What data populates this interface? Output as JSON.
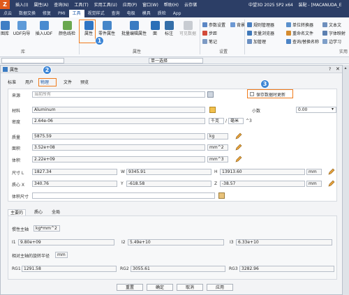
{
  "menubar": {
    "items": [
      "插入(I)",
      "属性(A)",
      "查询(N)",
      "工具(T)",
      "实用工具(U)",
      "应用(P)",
      "窗口(W)",
      "帮助(H)",
      "云存储"
    ],
    "title": "中望3D 2025 SP2 x64",
    "doc": "装配 - [MACANUDA_E"
  },
  "tabs": [
    "点云",
    "数据交换",
    "修复",
    "PMI",
    "工具",
    "视觉样式",
    "查询",
    "电极",
    "模具",
    "质检",
    "App"
  ],
  "ribbon": {
    "left_btns": [
      "图库",
      "UDF向导",
      "插入UDF",
      "属性",
      "零件属性",
      "批量编辑属性",
      "面",
      "标注",
      "可见数据"
    ],
    "glue_label": "颜色线检",
    "group_labels": {
      "lib": "库",
      "attr": "属性",
      "settings": "设置"
    },
    "settings": [
      "参数设置",
      "背景",
      "步距",
      "笔记"
    ],
    "tools": [
      "规则管理器",
      "单位转换器",
      "文本文",
      "变量浏览器",
      "重命名文件",
      "字体映射",
      "加管理",
      "查询/替换名称",
      "边学习"
    ],
    "right_label": "实用"
  },
  "filter": {
    "left": "",
    "mode": "单一选择"
  },
  "dialog": {
    "title": "属性",
    "tabs": [
      "标准",
      "用户",
      "物理",
      "文件",
      "预览"
    ],
    "active_tab": "物理",
    "source_label": "来源",
    "source_value": "当前所有",
    "material_label": "材料",
    "material_value": "Aluminum",
    "decimal_label": "小数",
    "decimal_value": "0.00",
    "density_label": "密度",
    "density_value": "2.64e-06",
    "density_unit1": "千克",
    "density_unit2": "毫米",
    "density_exp": "^3",
    "save_checkbox_label": "保存数据时更新",
    "mass_label": "质量",
    "mass_value": "5875.59",
    "mass_unit": "kg",
    "area_label": "面积",
    "area_value": "3.52e+08",
    "area_unit": "mm^2",
    "volume_label": "体积",
    "volume_value": "2.22e+09",
    "volume_unit": "mm^3",
    "size_label": "尺寸 L",
    "size_l": "1827.34",
    "size_w_label": "W",
    "size_w": "9345.91",
    "size_h_label": "H",
    "size_h": "13913.60",
    "size_unit": "mm",
    "cent_label": "质心 X",
    "cent_x": "340.76",
    "cent_y_label": "Y",
    "cent_y": "-618.58",
    "cent_z_label": "Z",
    "cent_z": "-38.57",
    "cent_unit": "mm",
    "bbox_label": "体积尺寸",
    "subtabs": [
      "主要的",
      "质心",
      "全局"
    ],
    "inertia_label": "惯性主轴",
    "inertia_unit": "kg*mm^2",
    "i1_label": "I1",
    "i1": "9.80e+09",
    "i2_label": "I2",
    "i2": "5.49e+10",
    "i3_label": "I3",
    "i3": "6.33e+10",
    "rg_label": "相对主轴的旋转半径",
    "rg_unit": "mm",
    "rg1_label": "RG1",
    "rg1": "1291.58",
    "rg2_label": "RG2",
    "rg2": "3055.61",
    "rg3_label": "RG3",
    "rg3": "3282.96",
    "buttons": [
      "重置",
      "确定",
      "取消",
      "应用"
    ]
  },
  "badges": [
    "1",
    "2",
    "3"
  ],
  "colors": {
    "menubar": "#2c3e66",
    "highlight": "#f07b1c",
    "badge": "#3d86d6",
    "accent": "#1d5aa8"
  }
}
